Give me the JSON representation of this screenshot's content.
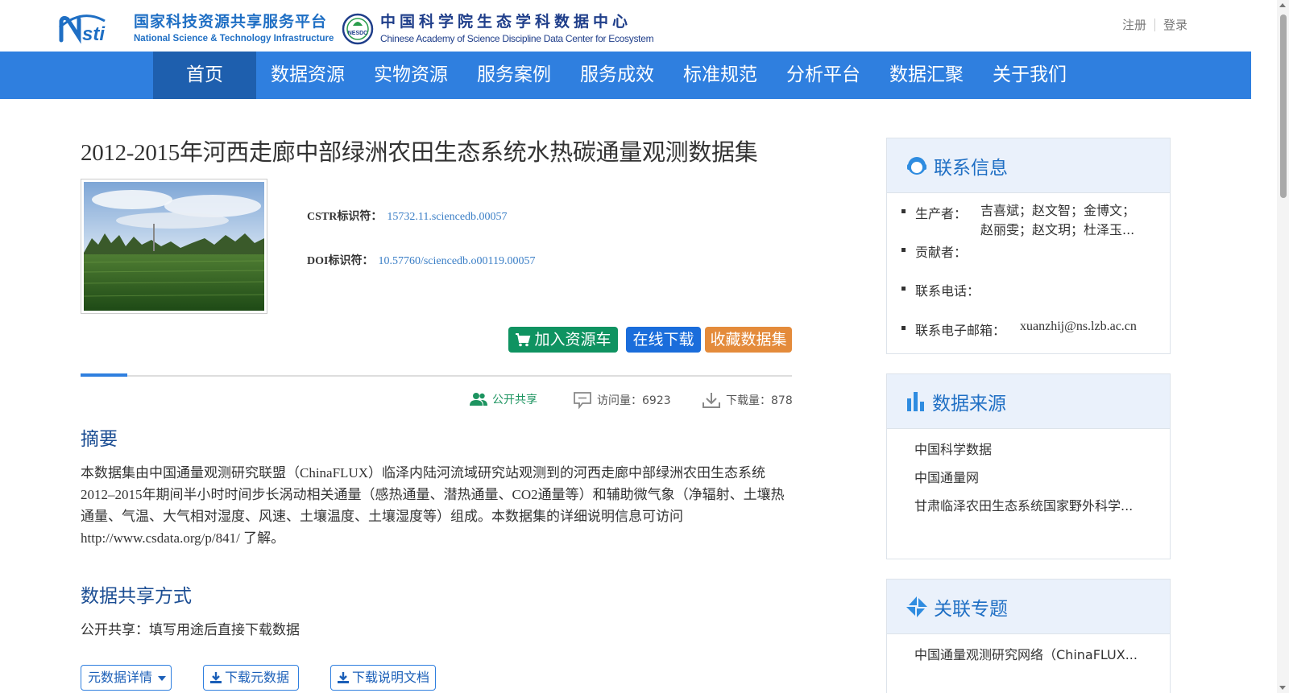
{
  "header": {
    "logo1_cn": "国家科技资源共享服务平台",
    "logo1_en": "National Science & Technology Infrastructure",
    "logo1_mark": "nsti",
    "logo2_cn": "中国科学院生态学科数据中心",
    "logo2_en": "Chinese Academy of Science Discipline Data Center for Ecosystem",
    "logo2_mark": "NESDC",
    "register": "注册",
    "login": "登录"
  },
  "nav": {
    "items": [
      "首页",
      "数据资源",
      "实物资源",
      "服务案例",
      "服务成效",
      "标准规范",
      "分析平台",
      "数据汇聚",
      "关于我们"
    ],
    "active": "首页"
  },
  "dataset": {
    "title": "2012-2015年河西走廊中部绿洲农田生态系统水热碳通量观测数据集",
    "cstr_label": "CSTR标识符：",
    "cstr_value": "15732.11.sciencedb.00057",
    "doi_label": "DOI标识符：",
    "doi_value": "10.57760/sciencedb.o00119.00057"
  },
  "actions": {
    "add_cart": "加入资源车",
    "download_online": "在线下载",
    "favorite": "收藏数据集"
  },
  "stats": {
    "share": "公开共享",
    "visits": "访问量：6923",
    "downloads": "下载量：878"
  },
  "abstract": {
    "heading": "摘要",
    "text": "本数据集由中国通量观测研究联盟（ChinaFLUX）临泽内陆河流域研究站观测到的河西走廊中部绿洲农田生态系统2012–2015年期间半小时时间步长涡动相关通量（感热通量、潜热通量、CO2通量等）和辅助微气象（净辐射、土壤热通量、气温、大气相对湿度、风速、土壤温度、土壤湿度等）组成。本数据集的详细说明信息可访问 http://www.csdata.org/p/841/ 了解。"
  },
  "sharing": {
    "heading": "数据共享方式",
    "text": "公开共享：填写用途后直接下载数据"
  },
  "bottom_buttons": {
    "metadata_detail": "元数据详情",
    "download_metadata": "下载元数据",
    "download_doc": "下载说明文档"
  },
  "contact": {
    "heading": "联系信息",
    "producer_label": "生产者：",
    "producer_line1": "吉喜斌；赵文智；金博文；",
    "producer_line2": "赵丽雯；赵文玥；杜泽玉...",
    "contributor_label": "贡献者：",
    "phone_label": "联系电话：",
    "email_label": "联系电子邮箱：",
    "email_value": "xuanzhij@ns.lzb.ac.cn"
  },
  "sources": {
    "heading": "数据来源",
    "items": [
      "中国科学数据",
      "中国通量网",
      "甘肃临泽农田生态系统国家野外科学..."
    ]
  },
  "topics": {
    "heading": "关联专题",
    "items": [
      "中国通量观测研究网络（ChinaFLUX..."
    ]
  },
  "colors": {
    "nav_bg": "#2f7fdf",
    "nav_active": "#1e5fae",
    "cart_green": "#0f9361",
    "download_blue": "#1a6ddb",
    "favorite_orange": "#e48b3b",
    "heading_blue": "#1b4d93"
  }
}
